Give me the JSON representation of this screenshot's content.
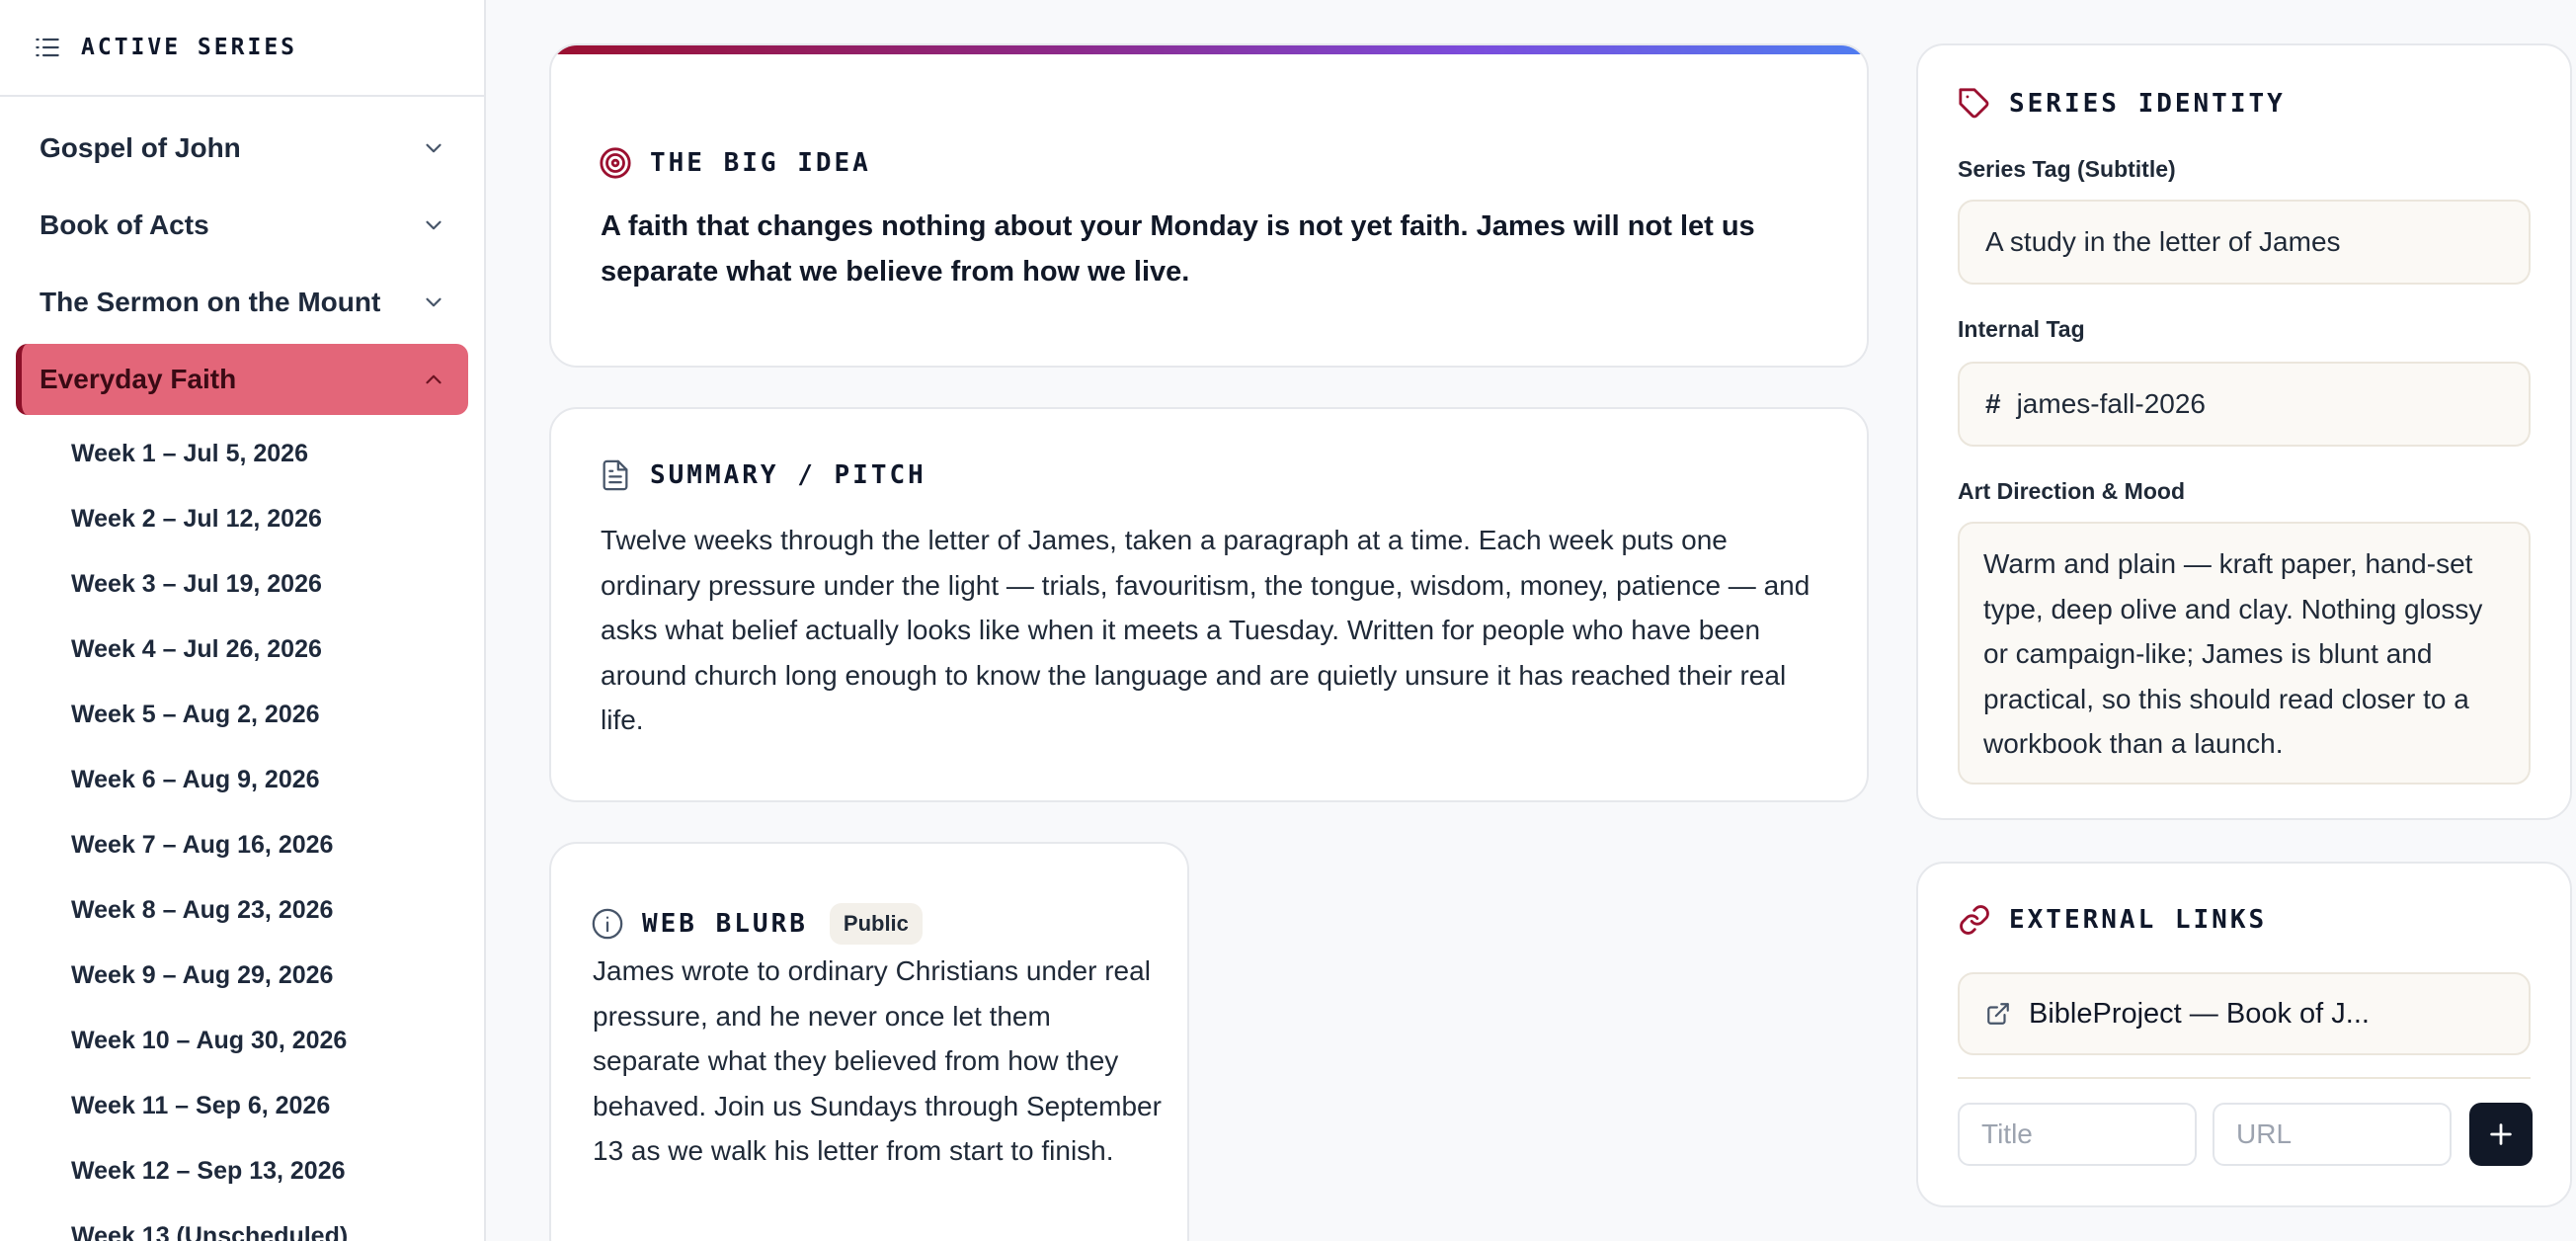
{
  "sidebar": {
    "title": "ACTIVE SERIES",
    "series": [
      {
        "label": "Gospel of John"
      },
      {
        "label": "Book of Acts"
      },
      {
        "label": "The Sermon on the Mount"
      },
      {
        "label": "Everyday Faith"
      }
    ],
    "weeks": [
      "Week 1 – Jul 5, 2026",
      "Week 2 – Jul 12, 2026",
      "Week 3 – Jul 19, 2026",
      "Week 4 – Jul 26, 2026",
      "Week 5 – Aug 2, 2026",
      "Week 6 – Aug 9, 2026",
      "Week 7 – Aug 16, 2026",
      "Week 8 – Aug 23, 2026",
      "Week 9 – Aug 29, 2026",
      "Week 10 – Aug 30, 2026",
      "Week 11 – Sep 6, 2026",
      "Week 12 – Sep 13, 2026",
      "Week 13 (Unscheduled)"
    ]
  },
  "big_idea": {
    "title": "THE BIG IDEA",
    "text": "A faith that changes nothing about your Monday is not yet faith. James will not let us separate what we believe from how we live."
  },
  "summary": {
    "title": "SUMMARY / PITCH",
    "text": "Twelve weeks through the letter of James, taken a paragraph at a time. Each week puts one ordinary pressure under the light — trials, favouritism, the tongue, wisdom, money, patience — and asks what belief actually looks like when it meets a Tuesday. Written for people who have been around church long enough to know the language and are quietly unsure it has reached their real life."
  },
  "web_blurb": {
    "title": "WEB BLURB",
    "badge": "Public",
    "text": "James wrote to ordinary Christians under real pressure, and he never once let them separate what they believed from how they behaved. Join us Sundays through September 13 as we walk his letter from start to finish."
  },
  "identity": {
    "title": "SERIES IDENTITY",
    "tag_label": "Series Tag (Subtitle)",
    "tag_value": "A study in the letter of James",
    "internal_label": "Internal Tag",
    "internal_prefix": "#",
    "internal_value": "james-fall-2026",
    "art_label": "Art Direction & Mood",
    "art_value": "Warm and plain — kraft paper, hand-set type, deep olive and clay. Nothing glossy or campaign-like; James is blunt and practical, so this should read closer to a workbook than a launch."
  },
  "links": {
    "title": "EXTERNAL LINKS",
    "items": [
      {
        "label": "BibleProject — Book of J..."
      }
    ],
    "title_placeholder": "Title",
    "url_placeholder": "URL"
  },
  "colors": {
    "accent": "#8b1028",
    "active_bg": "#e36679",
    "dark_button": "#111827"
  }
}
